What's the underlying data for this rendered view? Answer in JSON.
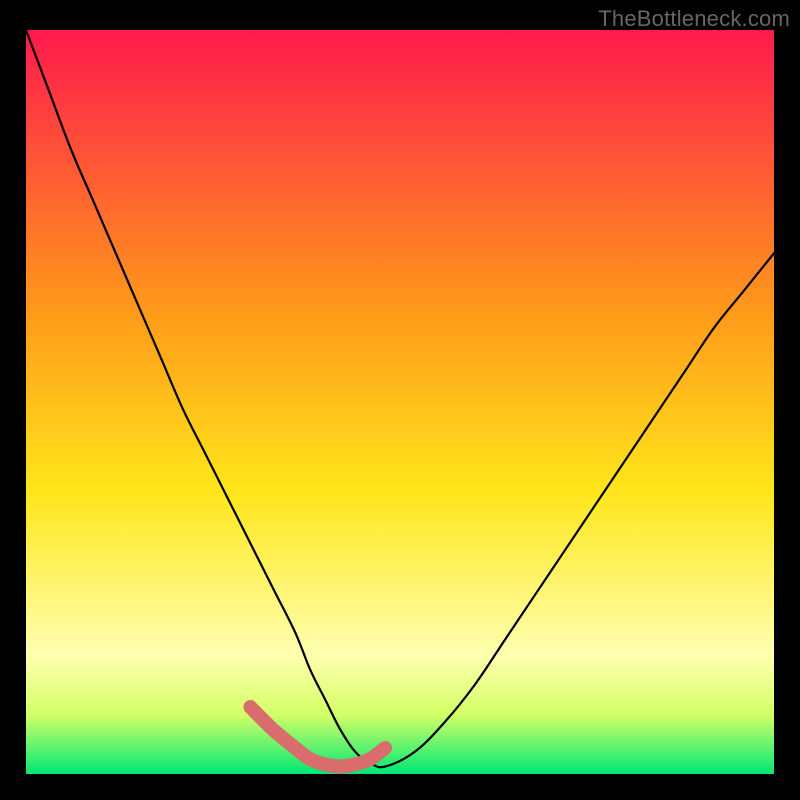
{
  "watermark": "TheBottleneck.com",
  "colors": {
    "bg": "#000000",
    "grad_top": "#ff1a4d",
    "grad_mid1": "#ff9a1a",
    "grad_mid2": "#ffe61a",
    "grad_pale": "#ffffb0",
    "grad_bottom": "#00e874",
    "curve": "#000000",
    "overlay_segment": "#d96d6d"
  },
  "chart_data": {
    "type": "line",
    "title": "",
    "xlabel": "",
    "ylabel": "",
    "xlim": [
      0,
      100
    ],
    "ylim": [
      0,
      100
    ],
    "x": [
      0,
      3,
      6,
      9,
      12,
      15,
      18,
      21,
      24,
      27,
      30,
      33,
      36,
      38,
      40,
      42,
      44,
      46,
      48,
      52,
      56,
      60,
      64,
      68,
      72,
      76,
      80,
      84,
      88,
      92,
      96,
      100
    ],
    "values": [
      100,
      92,
      84,
      77,
      70,
      63,
      56,
      49,
      43,
      37,
      31,
      25,
      19,
      14,
      10,
      6,
      3,
      1.5,
      1,
      3,
      7,
      12,
      18,
      24,
      30,
      36,
      42,
      48,
      54,
      60,
      65,
      70
    ],
    "overlay_segment": {
      "x": [
        30,
        33,
        36,
        38,
        40,
        42,
        44,
        46,
        48
      ],
      "values": [
        9,
        6,
        3.5,
        2,
        1.3,
        1,
        1.3,
        2,
        3.5
      ]
    },
    "gradient_stops": [
      {
        "offset": 0.0,
        "color": "#ff1a4d"
      },
      {
        "offset": 0.38,
        "color": "#ff9a1a"
      },
      {
        "offset": 0.62,
        "color": "#ffe61a"
      },
      {
        "offset": 0.84,
        "color": "#ffffb0"
      },
      {
        "offset": 0.92,
        "color": "#d4ff66"
      },
      {
        "offset": 1.0,
        "color": "#00e874"
      }
    ]
  }
}
